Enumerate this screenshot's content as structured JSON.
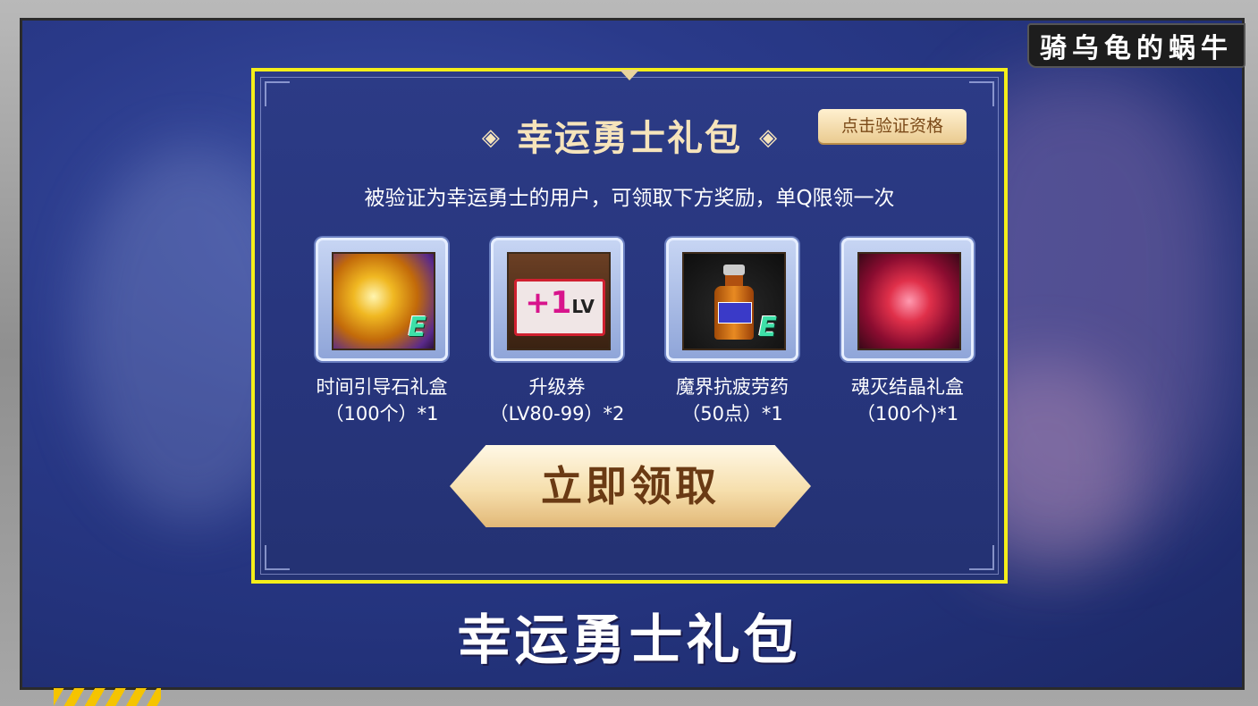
{
  "watermark": "骑乌龟的蜗牛",
  "panel": {
    "title": "幸运勇士礼包",
    "title_left_deco": "◈",
    "title_right_deco": "◈",
    "verify_button": "点击验证资格",
    "subtitle": "被验证为幸运勇士的用户，可领取下方奖励，单Q限领一次",
    "items": [
      {
        "name_line1": "时间引导石礼盒",
        "name_line2": "（100个）*1",
        "icon": "golden-orb-icon"
      },
      {
        "name_line1": "升级券",
        "name_line2": "（LV80-99）*2",
        "icon": "level-ticket-icon"
      },
      {
        "name_line1": "魔界抗疲劳药",
        "name_line2": "（50点）*1",
        "icon": "potion-bottle-icon"
      },
      {
        "name_line1": "魂灭结晶礼盒",
        "name_line2": "（100个)*1",
        "icon": "crystal-icon"
      }
    ],
    "ticket_plus": "+1",
    "ticket_lv": "LV",
    "badge_e": "E",
    "claim_button": "立即领取"
  },
  "caption": "幸运勇士礼包",
  "colors": {
    "panel_border": "#f4ee1a",
    "title": "#f6e4bb",
    "button_text": "#7b4a18"
  }
}
